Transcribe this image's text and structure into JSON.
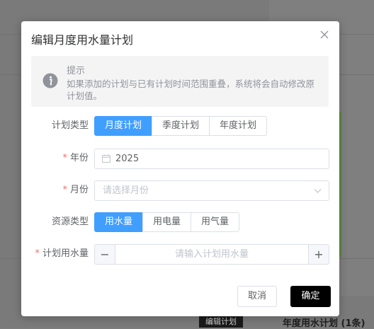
{
  "background": {
    "edit_button_label": "编辑计划",
    "plan_title": "年度用水计划 (1条)"
  },
  "dialog": {
    "title": "编辑月度用水量计划",
    "alert": {
      "title": "提示",
      "description": "如果添加的计划与已有计划时间范围重叠，系统将会自动修改原计划值。"
    },
    "plan_type": {
      "label": "计划类型",
      "options": [
        "月度计划",
        "季度计划",
        "年度计划"
      ],
      "selected": "月度计划"
    },
    "year": {
      "label": "年份",
      "value": "2025"
    },
    "month": {
      "label": "月份",
      "placeholder": "请选择月份"
    },
    "resource_type": {
      "label": "资源类型",
      "options": [
        "用水量",
        "用电量",
        "用气量"
      ],
      "selected": "用水量"
    },
    "planned_water": {
      "label": "计划用水量",
      "placeholder": "请输入计划用水量",
      "minus": "−",
      "plus": "+"
    },
    "cancel_label": "取消",
    "confirm_label": "确定"
  },
  "colors": {
    "primary": "#409eff",
    "required": "#f56c6c",
    "confirm_bg": "#000000"
  }
}
